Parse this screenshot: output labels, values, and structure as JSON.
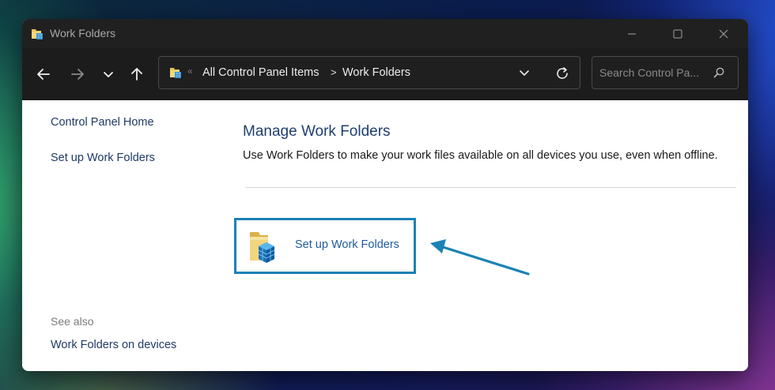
{
  "window": {
    "title": "Work Folders",
    "controls": {
      "minimize": "minimize-icon",
      "maximize": "maximize-icon",
      "close": "close-icon"
    }
  },
  "navigation": {
    "back": "back-arrow-icon",
    "forward": "forward-arrow-icon",
    "recent": "chevron-down-icon",
    "up": "up-arrow-icon"
  },
  "address_bar": {
    "leading_separator": "«",
    "breadcrumbs": [
      "All Control Panel Items",
      "Work Folders"
    ],
    "separator": ">"
  },
  "search": {
    "placeholder": "Search Control Pa..."
  },
  "sidebar": {
    "links": [
      "Control Panel Home",
      "Set up Work Folders"
    ],
    "see_also_label": "See also",
    "see_also_links": [
      "Work Folders on devices"
    ]
  },
  "main": {
    "heading": "Manage Work Folders",
    "description": "Use Work Folders to make your work files available on all devices you use, even when offline.",
    "tasks": [
      {
        "label": "Set up Work Folders",
        "icon": "work-folders-icon"
      }
    ]
  },
  "colors": {
    "titlebar": "#202020",
    "navbar": "#1c1c1c",
    "heading": "#1e3f6e",
    "link": "#1f5b9b",
    "highlight": "#1a82b5"
  }
}
